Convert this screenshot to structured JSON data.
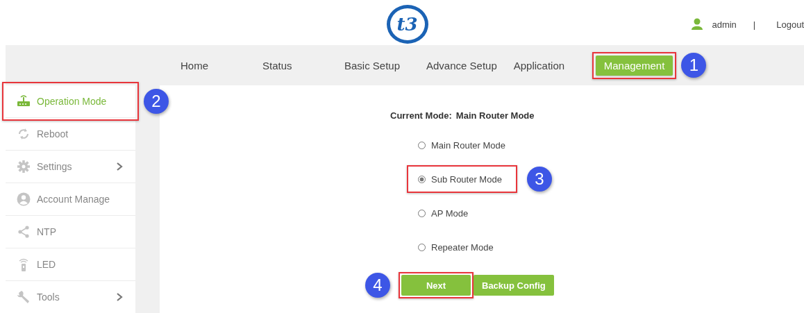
{
  "header": {
    "logo": "t3",
    "user": "admin",
    "separator": "|",
    "logout": "Logout"
  },
  "nav": [
    {
      "label": "Home",
      "selected": false,
      "highlighted": false
    },
    {
      "label": "Status",
      "selected": false,
      "highlighted": false
    },
    {
      "label": "Basic Setup",
      "selected": false,
      "highlighted": false
    },
    {
      "label": "Advance Setup",
      "selected": false,
      "highlighted": false
    },
    {
      "label": "Application",
      "selected": false,
      "highlighted": false
    },
    {
      "label": "Management",
      "selected": true,
      "highlighted": true,
      "callout": "1"
    }
  ],
  "sidebar": {
    "items": [
      {
        "label": "Operation Mode",
        "selected": true,
        "highlighted": true,
        "callout": "2",
        "submenu": false
      },
      {
        "label": "Reboot",
        "selected": false,
        "highlighted": false,
        "submenu": false
      },
      {
        "label": "Settings",
        "selected": false,
        "highlighted": false,
        "submenu": true
      },
      {
        "label": "Account Manage",
        "selected": false,
        "highlighted": false,
        "submenu": false
      },
      {
        "label": "NTP",
        "selected": false,
        "highlighted": false,
        "submenu": false
      },
      {
        "label": "LED",
        "selected": false,
        "highlighted": false,
        "submenu": false
      },
      {
        "label": "Tools",
        "selected": false,
        "highlighted": false,
        "submenu": true
      }
    ]
  },
  "content": {
    "current_mode_label": "Current Mode:",
    "current_mode_value": "Main Router Mode",
    "modes": [
      {
        "label": "Main Router Mode",
        "selected": false,
        "highlighted": false
      },
      {
        "label": "Sub Router Mode",
        "selected": true,
        "highlighted": true,
        "callout": "3"
      },
      {
        "label": "AP Mode",
        "selected": false,
        "highlighted": false
      },
      {
        "label": "Repeater Mode",
        "selected": false,
        "highlighted": false
      }
    ],
    "buttons": [
      {
        "label": "Next",
        "highlighted": true,
        "callout": "4"
      },
      {
        "label": "Backup Config",
        "highlighted": false
      }
    ]
  }
}
